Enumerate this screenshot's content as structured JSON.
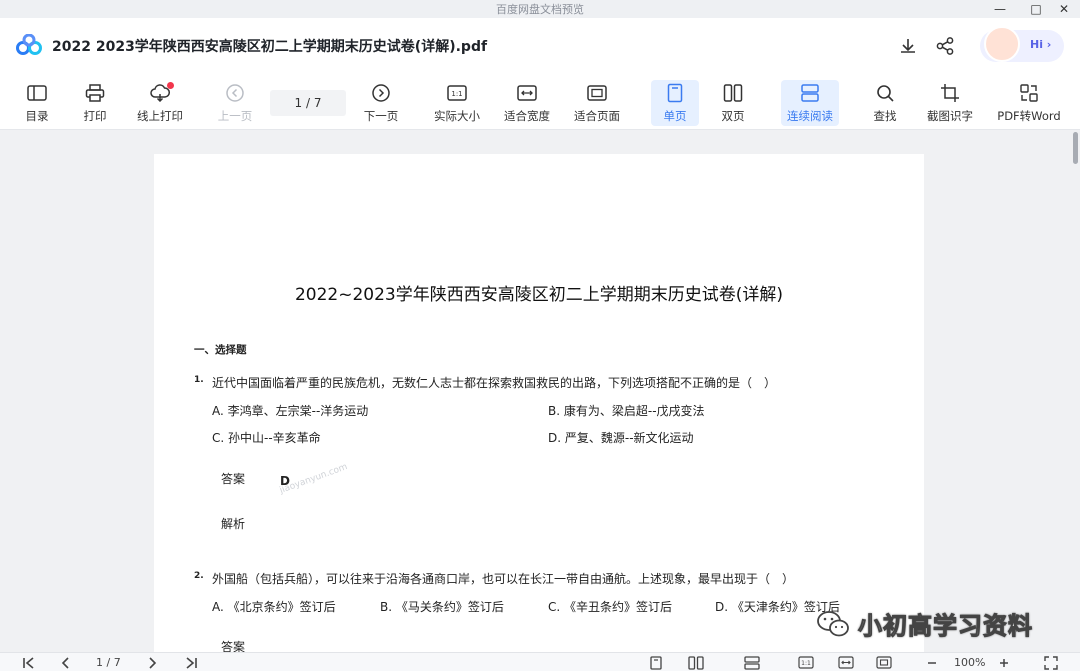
{
  "window": {
    "title": "百度网盘文档预览"
  },
  "header": {
    "doc_title": "2022 2023学年陕西西安高陵区初二上学期期末历史试卷(详解).pdf",
    "assistant_label": "Hi ›"
  },
  "toolbar": {
    "toc": "目录",
    "print": "打印",
    "online_print": "线上打印",
    "prev_page": "上一页",
    "page_indicator": "1 / 7",
    "next_page": "下一页",
    "actual_size": "实际大小",
    "fit_width": "适合宽度",
    "fit_page": "适合页面",
    "single_page": "单页",
    "double_page": "双页",
    "continuous": "连续阅读",
    "find": "查找",
    "ocr": "截图识字",
    "pdf_to_word": "PDF转Word"
  },
  "document": {
    "title": "2022~2023学年陕西西安高陵区初二上学期期末历史试卷(详解)",
    "section": "一、选择题",
    "q1": {
      "num": "1.",
      "text": "近代中国面临着严重的民族危机，无数仁人志士都在探索救国救民的出路，下列选项搭配不正确的是（　）",
      "a": "A. 李鸿章、左宗棠--洋务运动",
      "b": "B. 康有为、梁启超--戊戌变法",
      "c": "C. 孙中山--辛亥革命",
      "d": "D. 严复、魏源--新文化运动",
      "answer_label": "答案",
      "answer": "D",
      "analysis_label": "解析"
    },
    "q2": {
      "num": "2.",
      "text": "外国船（包括兵船），可以往来于沿海各通商口岸，也可以在长江一带自由通航。上述现象，最早出现于（　）",
      "a": "A. 《北京条约》签订后",
      "b": "B. 《马关条约》签订后",
      "c": "C. 《辛丑条约》签订后",
      "d": "D. 《天津条约》签订后",
      "answer_label": "答案"
    },
    "watermark": "jiaoyanyun.com"
  },
  "bottom_bar": {
    "page_indicator": "1 / 7",
    "zoom": "100%"
  },
  "overlay": {
    "wechat_label": "小初高学习资料"
  },
  "colors": {
    "accent": "#3a7bf0",
    "active_bg": "#e6f0ff",
    "red_dot": "#f2364c"
  }
}
